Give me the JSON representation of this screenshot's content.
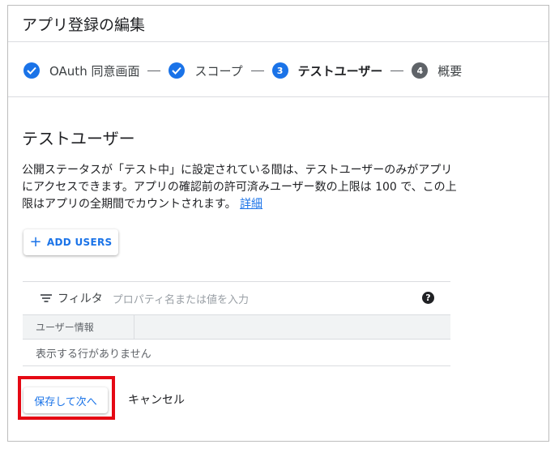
{
  "page": {
    "title": "アプリ登録の編集"
  },
  "stepper": {
    "steps": [
      {
        "label": "OAuth 同意画面",
        "state": "done"
      },
      {
        "label": "スコープ",
        "state": "done"
      },
      {
        "number": "3",
        "label": "テストユーザー",
        "state": "active"
      },
      {
        "number": "4",
        "label": "概要",
        "state": "upcoming"
      }
    ]
  },
  "section": {
    "heading": "テストユーザー",
    "description": "公開ステータスが「テスト中」に設定されている間は、テストユーザーのみがアプリにアクセスできます。アプリの確認前の許可済みユーザー数の上限は 100 で、この上限はアプリの全期間でカウントされます。",
    "link": "詳細"
  },
  "actions": {
    "add_users": "ADD USERS"
  },
  "table": {
    "filter_label": "フィルタ",
    "filter_placeholder": "プロパティ名または値を入力",
    "help": "?",
    "columns": [
      "ユーザー情報"
    ],
    "empty_message": "表示する行がありません"
  },
  "footer": {
    "save_label": "保存して次へ",
    "cancel_label": "キャンセル"
  },
  "colors": {
    "accent": "#1a73e8",
    "highlight": "#e50914",
    "inactive_step": "#5f6368"
  }
}
